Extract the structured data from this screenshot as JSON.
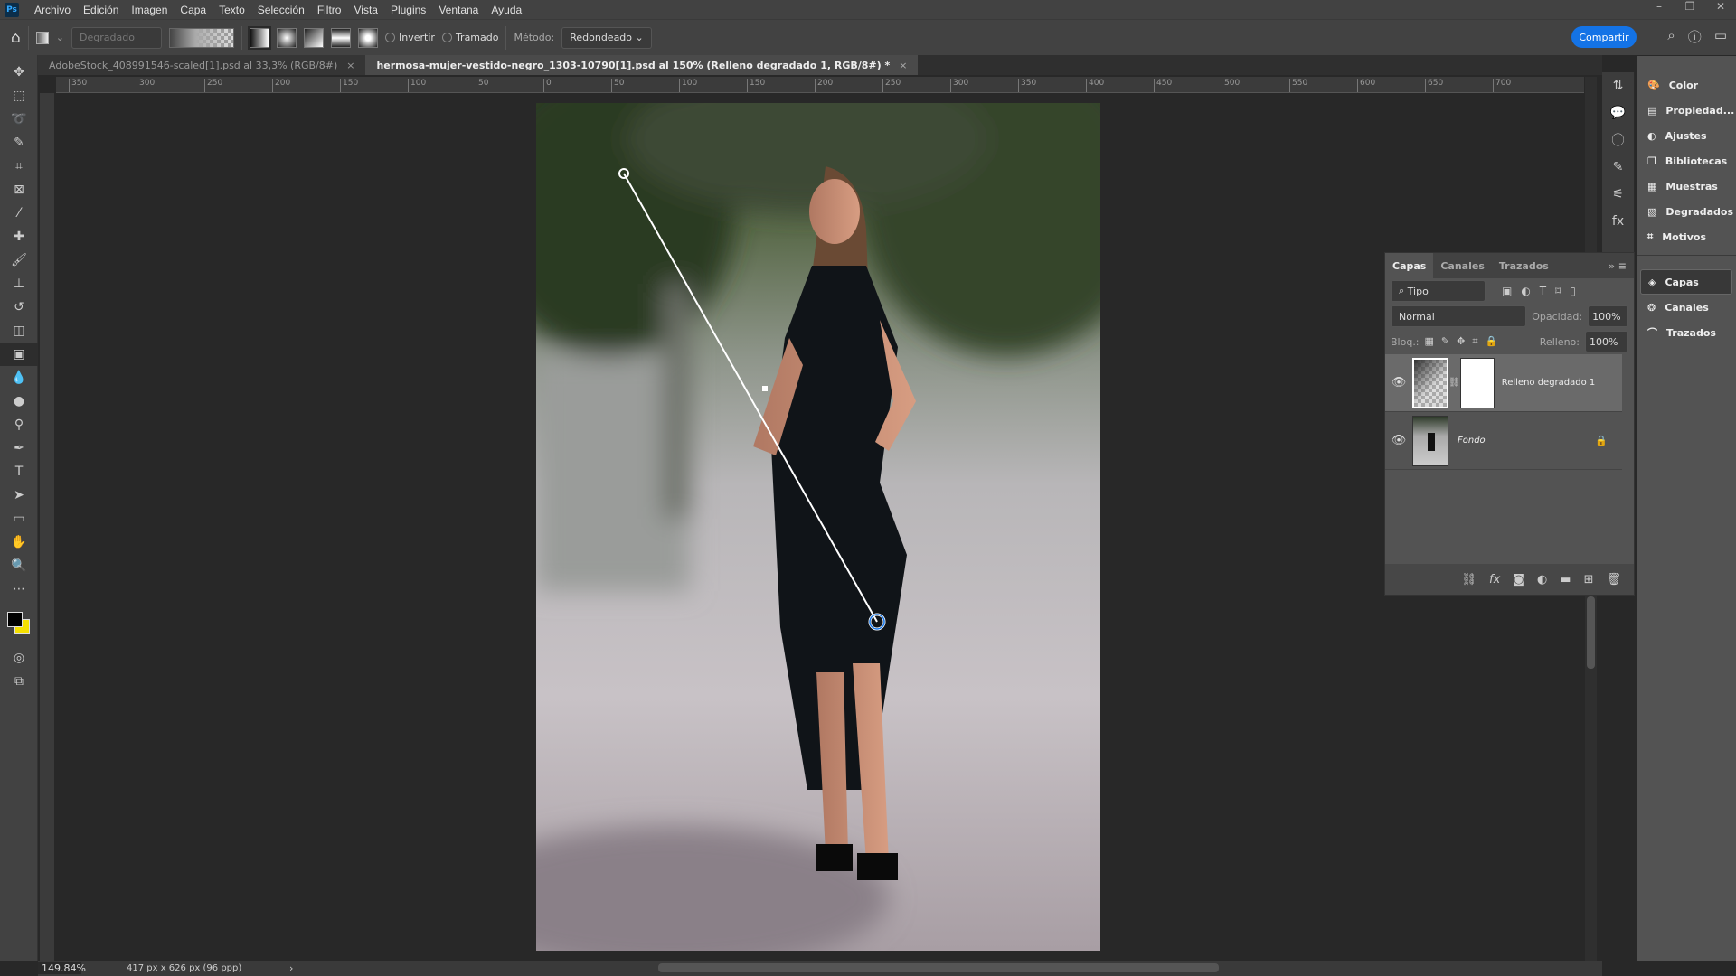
{
  "app": {
    "logo": "Ps",
    "menu": [
      "Archivo",
      "Edición",
      "Imagen",
      "Capa",
      "Texto",
      "Selección",
      "Filtro",
      "Vista",
      "Plugins",
      "Ventana",
      "Ayuda"
    ],
    "window_controls": [
      "–",
      "❐",
      "✕"
    ]
  },
  "options": {
    "preset": "Degradado",
    "invert_label": "Invertir",
    "dither_label": "Tramado",
    "method_label": "Método:",
    "method_value": "Redondeado",
    "share_label": "Compartir"
  },
  "tabs": [
    {
      "label": "AdobeStock_408991546-scaled[1].psd al 33,3% (RGB/8#)",
      "close": "×",
      "active": false
    },
    {
      "label": "hermosa-mujer-vestido-negro_1303-10790[1].psd al 150% (Relleno degradado 1, RGB/8#) *",
      "close": "×",
      "active": true
    }
  ],
  "ruler": [
    "350",
    "300",
    "250",
    "200",
    "150",
    "100",
    "50",
    "0",
    "50",
    "100",
    "150",
    "200",
    "250",
    "300",
    "350",
    "400",
    "450",
    "500",
    "550",
    "600",
    "650",
    "700"
  ],
  "status": {
    "zoom": "149.84%",
    "doc_info": "417 px x 626 px (96 ppp)"
  },
  "dock": {
    "items": [
      "Color",
      "Propiedad...",
      "Ajustes",
      "Bibliotecas",
      "Muestras",
      "Degradados",
      "Motivos"
    ],
    "group2": [
      "Capas",
      "Canales",
      "Trazados"
    ]
  },
  "layers_panel": {
    "tabs": [
      "Capas",
      "Canales",
      "Trazados"
    ],
    "filter": "Tipo",
    "blend_mode": "Normal",
    "opacity_label": "Opacidad:",
    "opacity": "100%",
    "lock_label": "Bloq.:",
    "fill_label": "Relleno:",
    "fill": "100%",
    "layers": [
      {
        "name": "Relleno degradado 1",
        "visible": true,
        "selected": true
      },
      {
        "name": "Fondo",
        "visible": true,
        "locked": true
      }
    ]
  },
  "colors": {
    "accent": "#1473e6",
    "foreground": "#000000",
    "background": "#f5e000"
  }
}
